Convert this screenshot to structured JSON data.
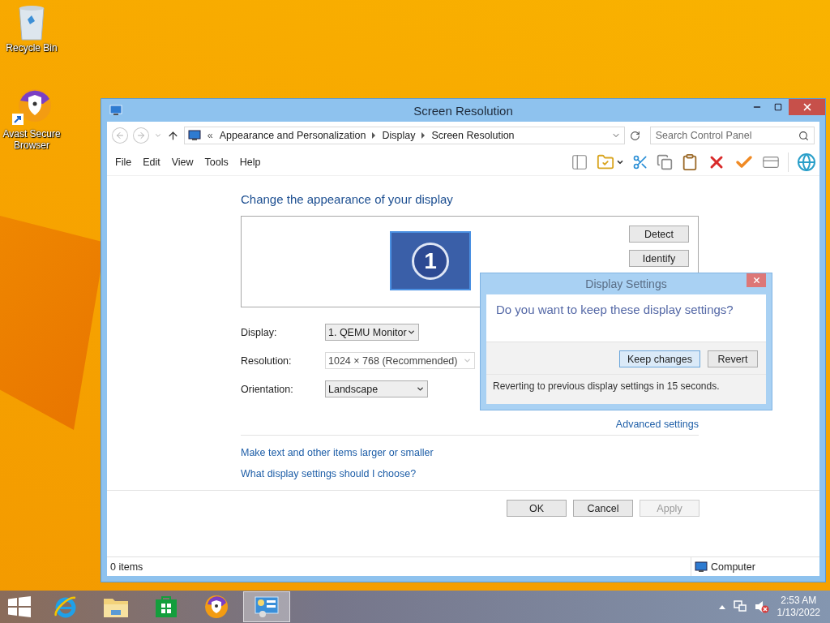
{
  "desktop_icons": [
    {
      "kind": "recycle",
      "label": "Recycle Bin"
    },
    {
      "kind": "browser",
      "label": "Avast Secure Browser"
    }
  ],
  "window": {
    "title": "Screen Resolution",
    "address": {
      "prefix": "«",
      "crumbs": [
        "Appearance and Personalization",
        "Display",
        "Screen Resolution"
      ]
    },
    "search": {
      "placeholder": "Search Control Panel"
    },
    "menu": [
      "File",
      "Edit",
      "View",
      "Tools",
      "Help"
    ],
    "heading": "Change the appearance of your display",
    "monitor": {
      "number": "1",
      "selected": true
    },
    "monitor_buttons": [
      "Detect",
      "Identify"
    ],
    "fields": [
      {
        "label": "Display:",
        "value": "1. QEMU Monitor",
        "disabled": false
      },
      {
        "label": "Resolution:",
        "value": "1024 × 768 (Recommended)",
        "disabled": true
      },
      {
        "label": "Orientation:",
        "value": "Landscape",
        "disabled": false
      }
    ],
    "advanced_link": "Advanced settings",
    "links": [
      "Make text and other items larger or smaller",
      "What display settings should I choose?"
    ],
    "buttons": [
      {
        "label": "OK",
        "disabled": false
      },
      {
        "label": "Cancel",
        "disabled": false
      },
      {
        "label": "Apply",
        "disabled": true
      }
    ],
    "status_bar": {
      "items": "0 items",
      "location": "Computer"
    }
  },
  "dialog": {
    "title": "Display Settings",
    "question": "Do you want to keep these display settings?",
    "buttons": [
      {
        "label": "Keep changes",
        "selected": true
      },
      {
        "label": "Revert",
        "selected": false
      }
    ],
    "note": "Reverting to previous display settings in 15 seconds."
  },
  "taskbar": {
    "apps": [
      {
        "kind": "ie",
        "selected": false
      },
      {
        "kind": "explorer",
        "selected": false
      },
      {
        "kind": "store",
        "selected": false
      },
      {
        "kind": "browser",
        "selected": false
      },
      {
        "kind": "display",
        "selected": true
      }
    ],
    "time": "2:53 AM",
    "date": "1/13/2022"
  }
}
